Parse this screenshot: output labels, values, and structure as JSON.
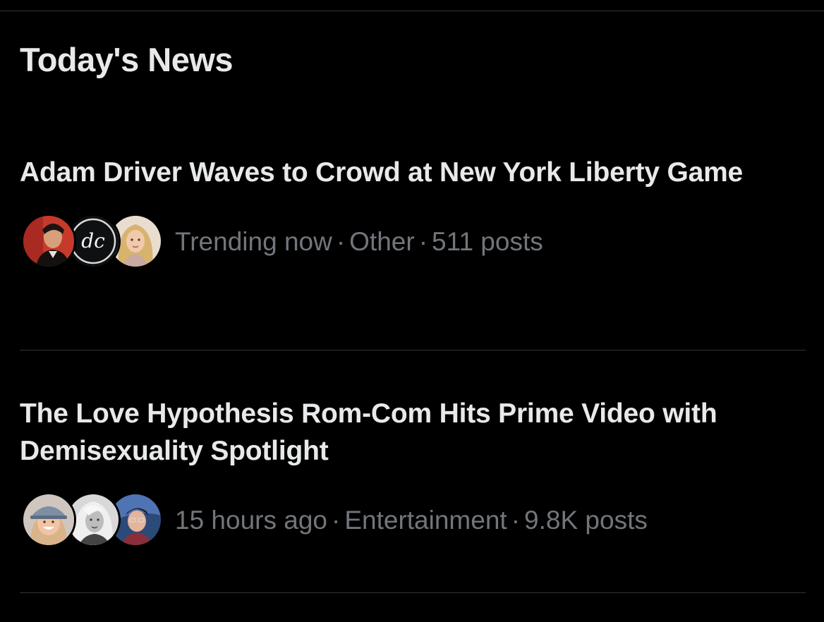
{
  "section": {
    "title": "Today's News"
  },
  "items": [
    {
      "headline": "Adam Driver Waves to Crowd at New York Liberty Game",
      "time": "Trending now",
      "category": "Other",
      "posts": "511 posts",
      "avatars": [
        "avatar-man-red-background",
        "avatar-dc-logo",
        "avatar-blonde-woman"
      ]
    },
    {
      "headline": "The Love Hypothesis Rom-Com Hits Prime Video with Demisexuality Spotlight",
      "time": "15 hours ago",
      "category": "Entertainment",
      "posts": "9.8K posts",
      "avatars": [
        "avatar-woman-cap",
        "avatar-blonde-woman-bw",
        "avatar-illustrated-man"
      ]
    }
  ],
  "separator": "·",
  "colors": {
    "background": "#000000",
    "headline": "#e7e9ea",
    "meta": "#71767b",
    "divider": "#2f3336"
  }
}
